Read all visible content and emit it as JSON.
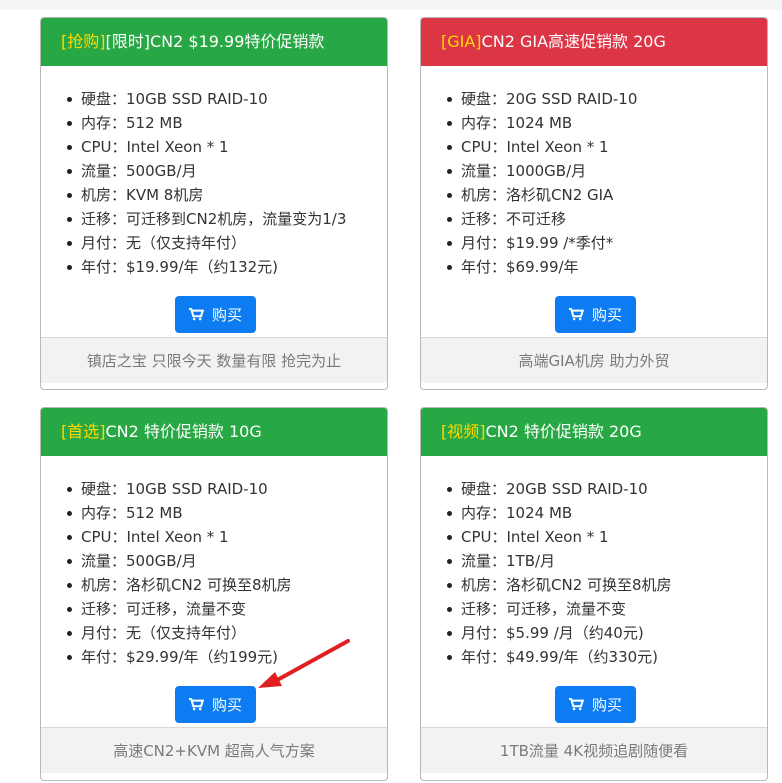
{
  "cards": [
    {
      "tag": "[抢购]",
      "title": "[限时]CN2 $19.99特价促销款",
      "theme": "#27a844",
      "specs": [
        "硬盘：10GB SSD RAID-10",
        "内存：512 MB",
        "CPU：Intel Xeon * 1",
        "流量：500GB/月",
        "机房：KVM 8机房",
        "迁移：可迁移到CN2机房，流量变为1/3",
        "月付：无（仅支持年付）",
        "年付：$19.99/年（约132元)"
      ],
      "button": "购买",
      "footer": "镇店之宝 只限今天 数量有限 抢完为止"
    },
    {
      "tag": "[GIA]",
      "title": "CN2 GIA高速促销款 20G",
      "theme": "#dc3545",
      "specs": [
        "硬盘：20G SSD RAID-10",
        "内存：1024 MB",
        "CPU：Intel Xeon * 1",
        "流量：1000GB/月",
        "机房：洛杉矶CN2 GIA",
        "迁移：不可迁移",
        "月付：$19.99 /*季付*",
        "年付：$69.99/年"
      ],
      "button": "购买",
      "footer": "高端GIA机房 助力外贸"
    },
    {
      "tag": "[首选]",
      "title": "CN2 特价促销款 10G",
      "theme": "#27a844",
      "specs": [
        "硬盘：10GB SSD RAID-10",
        "内存：512 MB",
        "CPU：Intel Xeon * 1",
        "流量：500GB/月",
        "机房：洛杉矶CN2 可换至8机房",
        "迁移：可迁移，流量不变",
        "月付：无（仅支持年付）",
        "年付：$29.99/年（约199元)"
      ],
      "button": "购买",
      "footer": "高速CN2+KVM 超高人气方案"
    },
    {
      "tag": "[视频]",
      "title": "CN2 特价促销款 20G",
      "theme": "#27a844",
      "specs": [
        "硬盘：20GB SSD RAID-10",
        "内存：1024 MB",
        "CPU：Intel Xeon * 1",
        "流量：1TB/月",
        "机房：洛杉矶CN2 可换至8机房",
        "迁移：可迁移，流量不变",
        "月付：$5.99 /月（约40元)",
        "年付：$49.99/年（约330元)"
      ],
      "button": "购买",
      "footer": "1TB流量 4K视频追剧随便看"
    }
  ],
  "colors": {
    "green": "#27a844",
    "red": "#dc3545",
    "tag": "#ffd800",
    "button": "#0d7cf2",
    "arrow": "#e02020"
  },
  "icons": {
    "button": "cart-icon",
    "annotation": "red-arrow-icon"
  }
}
